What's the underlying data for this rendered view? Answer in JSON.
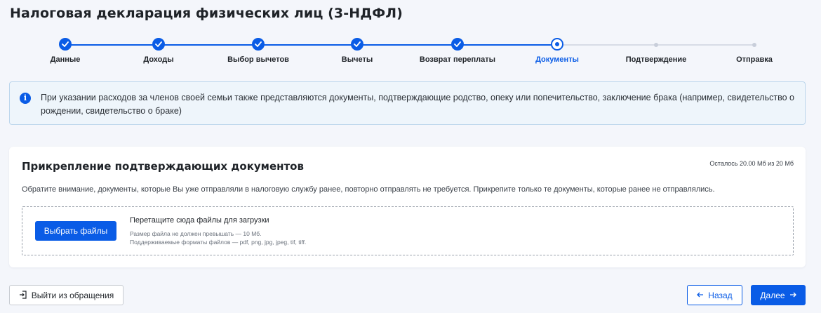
{
  "page": {
    "title": "Налоговая декларация физических лиц (3-НДФЛ)"
  },
  "stepper": {
    "steps": [
      {
        "label": "Данные",
        "state": "done"
      },
      {
        "label": "Доходы",
        "state": "done"
      },
      {
        "label": "Выбор вычетов",
        "state": "done"
      },
      {
        "label": "Вычеты",
        "state": "done"
      },
      {
        "label": "Возврат переплаты",
        "state": "done"
      },
      {
        "label": "Документы",
        "state": "current"
      },
      {
        "label": "Подтверждение",
        "state": "todo"
      },
      {
        "label": "Отправка",
        "state": "todo"
      }
    ],
    "colors": {
      "active": "#0a5ce6",
      "inactive": "#d7dce6"
    }
  },
  "info": {
    "icon": "info-icon",
    "text": "При указании расходов за членов своей семьи также представляются документы, подтверждающие родство, опеку или попечительство, заключение брака (например, свидетельство о рождении, свидетельство о браке)"
  },
  "upload": {
    "title": "Прикрепление подтверждающих документов",
    "quota": "Осталось 20.00 Мб из 20 Мб",
    "note": "Обратите внимание, документы, которые Вы уже отправляли в налоговую службу ранее, повторно отправлять не требуется. Прикрепите только те документы, которые ранее не отправлялись.",
    "choose_button": "Выбрать файлы",
    "drop_title": "Перетащите сюда файлы для загрузки",
    "size_hint": "Размер файла не должен превышать — 10 Мб.",
    "formats_hint": "Поддерживаемые форматы файлов — pdf, png, jpg, jpeg, tif, tiff."
  },
  "footer": {
    "exit_button": "Выйти из обращения",
    "back_button": "Назад",
    "next_button": "Далее",
    "exit_icon": "logout-icon",
    "back_icon": "arrow-left-icon",
    "next_icon": "arrow-right-icon"
  }
}
